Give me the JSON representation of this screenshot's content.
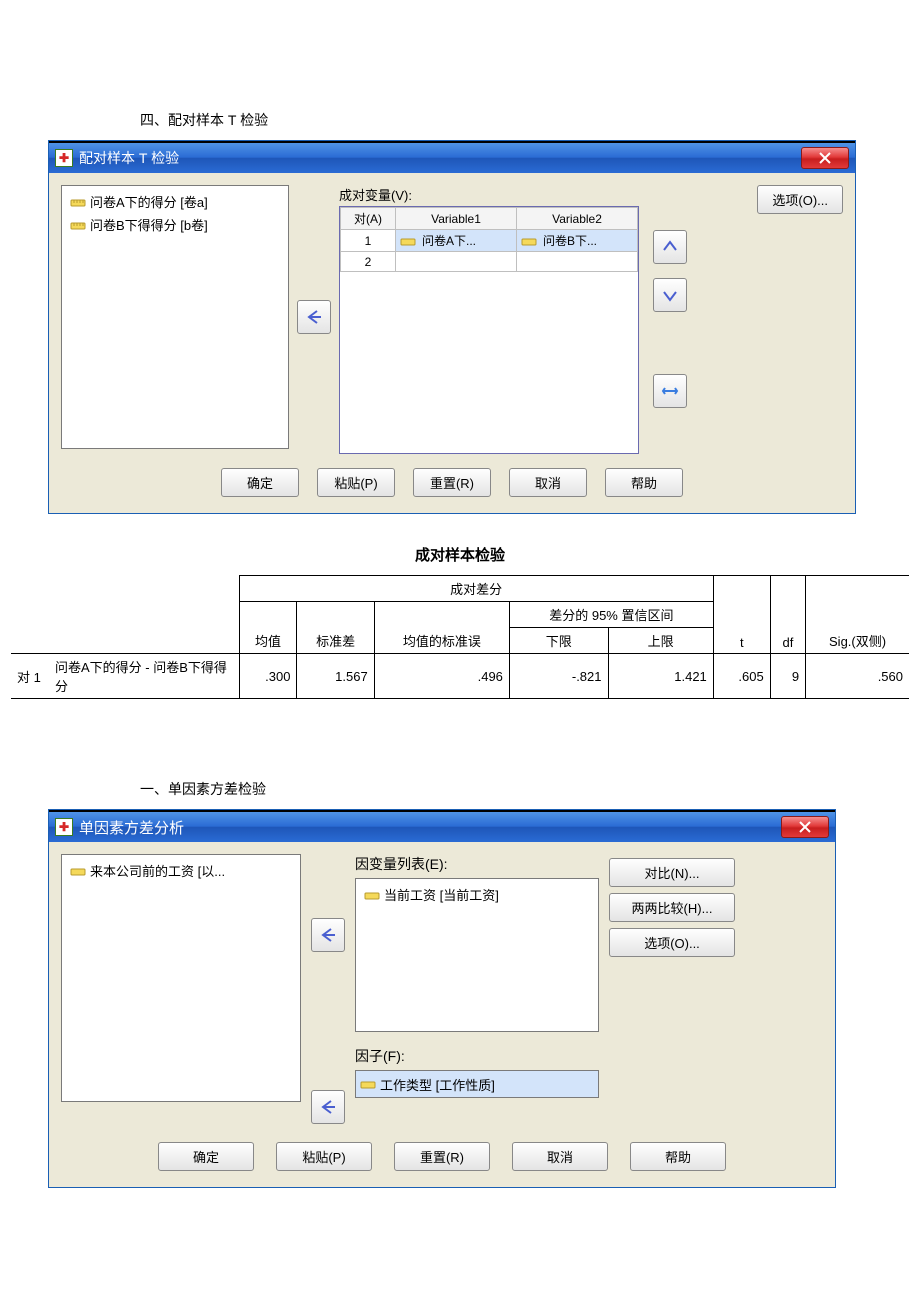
{
  "section1": "四、配对样本 T 检验",
  "section2": "一、单因素方差检验",
  "dialog1": {
    "title": "配对样本 T 检验",
    "vars": [
      "问卷A下的得分 [卷a]",
      "问卷B下得得分 [b卷]"
    ],
    "pairs_label": "成对变量(V):",
    "headers": {
      "pair": "对(A)",
      "v1": "Variable1",
      "v2": "Variable2"
    },
    "rows": [
      {
        "pair": "1",
        "v1": "问卷A下...",
        "v2": "问卷B下..."
      },
      {
        "pair": "2",
        "v1": "",
        "v2": ""
      }
    ],
    "options": "选项(O)...",
    "buttons": {
      "ok": "确定",
      "paste": "粘贴(P)",
      "reset": "重置(R)",
      "cancel": "取消",
      "help": "帮助"
    }
  },
  "results": {
    "title": "成对样本检验",
    "group_label": "成对差分",
    "ci_label": "差分的 95% 置信区间",
    "headers": {
      "mean": "均值",
      "sd": "标准差",
      "se": "均值的标准误",
      "low": "下限",
      "high": "上限",
      "t": "t",
      "df": "df",
      "sig": "Sig.(双侧)"
    },
    "row": {
      "label": "对 1",
      "name": "问卷A下的得分 - 问卷B下得得分",
      "mean": ".300",
      "sd": "1.567",
      "se": ".496",
      "low": "-.821",
      "high": "1.421",
      "t": ".605",
      "df": "9",
      "sig": ".560"
    }
  },
  "dialog2": {
    "title": "单因素方差分析",
    "src_vars": [
      "来本公司前的工资 [以..."
    ],
    "dep_label": "因变量列表(E):",
    "dep_vars": [
      "当前工资 [当前工资]"
    ],
    "factor_label": "因子(F):",
    "factor_var": "工作类型 [工作性质]",
    "side_buttons": {
      "contrast": "对比(N)...",
      "posthoc": "两两比较(H)...",
      "options": "选项(O)..."
    },
    "buttons": {
      "ok": "确定",
      "paste": "粘贴(P)",
      "reset": "重置(R)",
      "cancel": "取消",
      "help": "帮助"
    }
  }
}
